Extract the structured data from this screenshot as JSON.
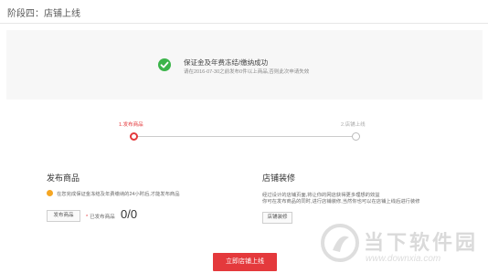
{
  "header": {
    "title": "阶段四：店铺上线"
  },
  "success": {
    "title": "保证金及年费冻结/缴纳成功",
    "description": "请在2016-07-30之前发布0件以上商品,否则此次申请失效"
  },
  "progress": {
    "steps": [
      {
        "label": "1.发布商品",
        "state": "active"
      },
      {
        "label": "2.店铺上线",
        "state": "inactive"
      }
    ]
  },
  "publish": {
    "title": "发布商品",
    "note": "在您完成保证金冻结及年费缴纳的24小时后,才能发布商品",
    "button_label": "发布商品",
    "published_label": "已发布商品",
    "published_count": "0/0"
  },
  "decorate": {
    "title": "店铺装修",
    "note_line1": "经过设计的店铺页面,将让你的网店获得更多理想的效益",
    "note_line2": "你可在发布商品的同时,进行店铺装修,当然你也可以在店铺上线后进行装修",
    "button_label": "店铺装修"
  },
  "footer": {
    "launch_label": "立即店铺上线"
  },
  "watermark": {
    "text": "当下软件园",
    "url": "www.downxia.com"
  },
  "colors": {
    "accent": "#e4393c",
    "success": "#3bb44a",
    "warning": "#f5a623"
  }
}
